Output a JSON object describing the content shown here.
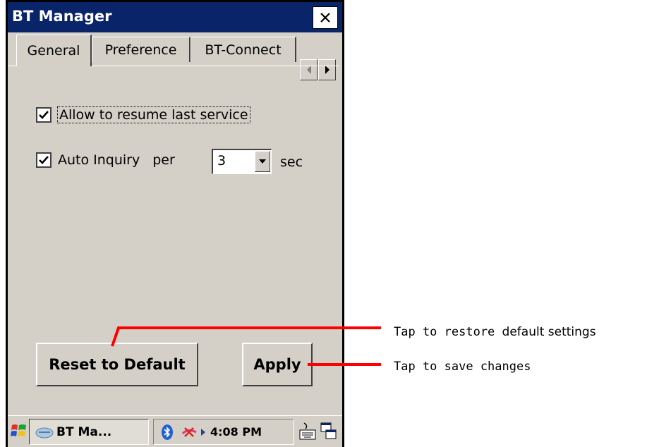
{
  "window": {
    "title": "BT Manager",
    "close_label": "×"
  },
  "tabs": [
    {
      "label": "General",
      "active": true
    },
    {
      "label": "Preference",
      "active": false
    },
    {
      "label": "BT-Connect",
      "active": false
    }
  ],
  "general": {
    "resume_checkbox": {
      "label": "Allow to resume last service",
      "checked": true
    },
    "inquiry_checkbox": {
      "label": "Auto Inquiry",
      "checked": true
    },
    "per_label": "per",
    "interval_value": "3",
    "sec_label": "sec"
  },
  "buttons": {
    "reset_label": "Reset to Default",
    "apply_label": "Apply"
  },
  "taskbar": {
    "task_label": "BT Ma...",
    "clock": "4:08 PM"
  },
  "annotations": {
    "reset_note_mono": "Tap to restore",
    "reset_note_sans": "default settings",
    "apply_note": "Tap to save changes",
    "line_color": "#ff0000"
  },
  "icons": [
    "close-icon",
    "tab-left-arrow-icon",
    "tab-right-arrow-icon",
    "checkmark-icon",
    "dropdown-arrow-icon",
    "start-flag-icon",
    "bt-app-icon",
    "bluetooth-icon",
    "network-icon",
    "keyboard-icon",
    "desktop-icon"
  ]
}
